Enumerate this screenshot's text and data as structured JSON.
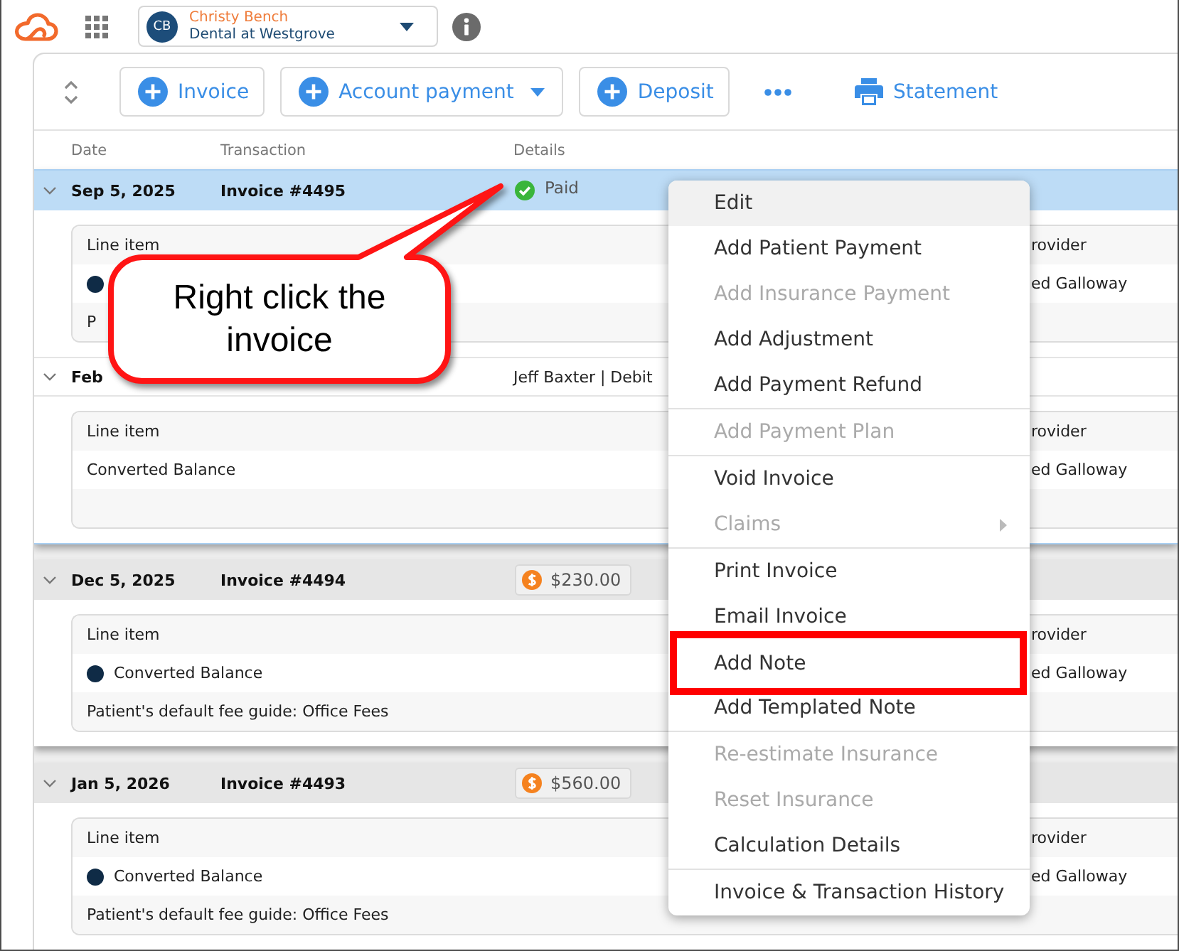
{
  "header": {
    "patient": {
      "initials": "CB",
      "name": "Christy Bench",
      "practice": "Dental at Westgrove"
    }
  },
  "toolbar": {
    "items": [
      {
        "kind": "add",
        "label": "Invoice"
      },
      {
        "kind": "add_menu",
        "label": "Account payment"
      },
      {
        "kind": "add",
        "label": "Deposit"
      },
      {
        "kind": "more"
      },
      {
        "kind": "print",
        "label": "Statement"
      }
    ]
  },
  "columns": [
    "Date",
    "Transaction",
    "Details"
  ],
  "groups": [
    {
      "selected": true,
      "expanded": true,
      "date": "Sep 5, 2025",
      "transaction": "Invoice #4495",
      "status": {
        "kind": "paid",
        "label": "Paid"
      },
      "entries": [
        {
          "kind": "card",
          "rows": [
            {
              "kind": "heading",
              "label": "Line item",
              "column_2": "rovider"
            },
            {
              "kind": "item",
              "dot": true,
              "column_2": "ed Galloway"
            },
            {
              "kind": "note",
              "label": "P"
            }
          ]
        },
        {
          "kind": "payment",
          "expanded": true,
          "date": "Feb",
          "details": "Jeff Baxter | Debit"
        },
        {
          "kind": "card",
          "rows": [
            {
              "kind": "heading",
              "label": "Line item",
              "column_2": "rovider"
            },
            {
              "kind": "item",
              "dot": false,
              "label": "Converted Balance",
              "column_2": "ed Galloway"
            },
            {
              "kind": "blank"
            }
          ]
        }
      ]
    },
    {
      "selected": false,
      "expanded": true,
      "date": "Dec 5, 2025",
      "transaction": "Invoice #4494",
      "status": {
        "kind": "balance",
        "label": "$230.00"
      },
      "entries": [
        {
          "kind": "card",
          "rows": [
            {
              "kind": "heading",
              "label": "Line item",
              "column_2": "rovider"
            },
            {
              "kind": "item",
              "dot": true,
              "label": "Converted Balance",
              "column_2": "ed Galloway"
            },
            {
              "kind": "note",
              "label": "Patient's default fee guide: Office Fees"
            }
          ]
        }
      ]
    },
    {
      "selected": false,
      "expanded": true,
      "date": "Jan 5, 2026",
      "transaction": "Invoice #4493",
      "status": {
        "kind": "balance",
        "label": "$560.00"
      },
      "entries": [
        {
          "kind": "card",
          "rows": [
            {
              "kind": "heading",
              "label": "Line item",
              "column_2": "rovider"
            },
            {
              "kind": "item",
              "dot": true,
              "label": "Converted Balance",
              "column_2": "ed Galloway"
            },
            {
              "kind": "note",
              "label": "Patient's default fee guide: Office Fees"
            }
          ]
        }
      ]
    }
  ],
  "context_menu": {
    "sections": [
      {
        "items": [
          {
            "label": "Edit",
            "disabled": false,
            "highlighted": true,
            "submenu": false,
            "annotated": false
          },
          {
            "label": "Add Patient Payment",
            "disabled": false,
            "highlighted": false,
            "submenu": false,
            "annotated": false
          },
          {
            "label": "Add Insurance Payment",
            "disabled": true,
            "highlighted": false,
            "submenu": false,
            "annotated": false
          },
          {
            "label": "Add Adjustment",
            "disabled": false,
            "highlighted": false,
            "submenu": false,
            "annotated": false
          },
          {
            "label": "Add Payment Refund",
            "disabled": false,
            "highlighted": false,
            "submenu": false,
            "annotated": false
          }
        ]
      },
      {
        "items": [
          {
            "label": "Add Payment Plan",
            "disabled": true,
            "highlighted": false,
            "submenu": false,
            "annotated": false
          }
        ]
      },
      {
        "items": [
          {
            "label": "Void Invoice",
            "disabled": false,
            "highlighted": false,
            "submenu": false,
            "annotated": false
          },
          {
            "label": "Claims",
            "disabled": true,
            "highlighted": false,
            "submenu": true,
            "annotated": false
          }
        ]
      },
      {
        "items": [
          {
            "label": "Print Invoice",
            "disabled": false,
            "highlighted": false,
            "submenu": false,
            "annotated": false
          },
          {
            "label": "Email Invoice",
            "disabled": false,
            "highlighted": false,
            "submenu": false,
            "annotated": false
          },
          {
            "label": "Add Note",
            "disabled": false,
            "highlighted": false,
            "submenu": false,
            "annotated": true
          },
          {
            "label": "Add Templated Note",
            "disabled": false,
            "highlighted": false,
            "submenu": false,
            "annotated": false
          }
        ]
      },
      {
        "items": [
          {
            "label": "Re-estimate Insurance",
            "disabled": true,
            "highlighted": false,
            "submenu": false,
            "annotated": false
          },
          {
            "label": "Reset Insurance",
            "disabled": true,
            "highlighted": false,
            "submenu": false,
            "annotated": false
          },
          {
            "label": "Calculation Details",
            "disabled": false,
            "highlighted": false,
            "submenu": false,
            "annotated": false
          }
        ]
      },
      {
        "items": [
          {
            "label": "Invoice & Transaction History",
            "disabled": false,
            "highlighted": false,
            "submenu": false,
            "annotated": false
          }
        ]
      }
    ]
  },
  "callout": {
    "text": "Right click the invoice"
  }
}
